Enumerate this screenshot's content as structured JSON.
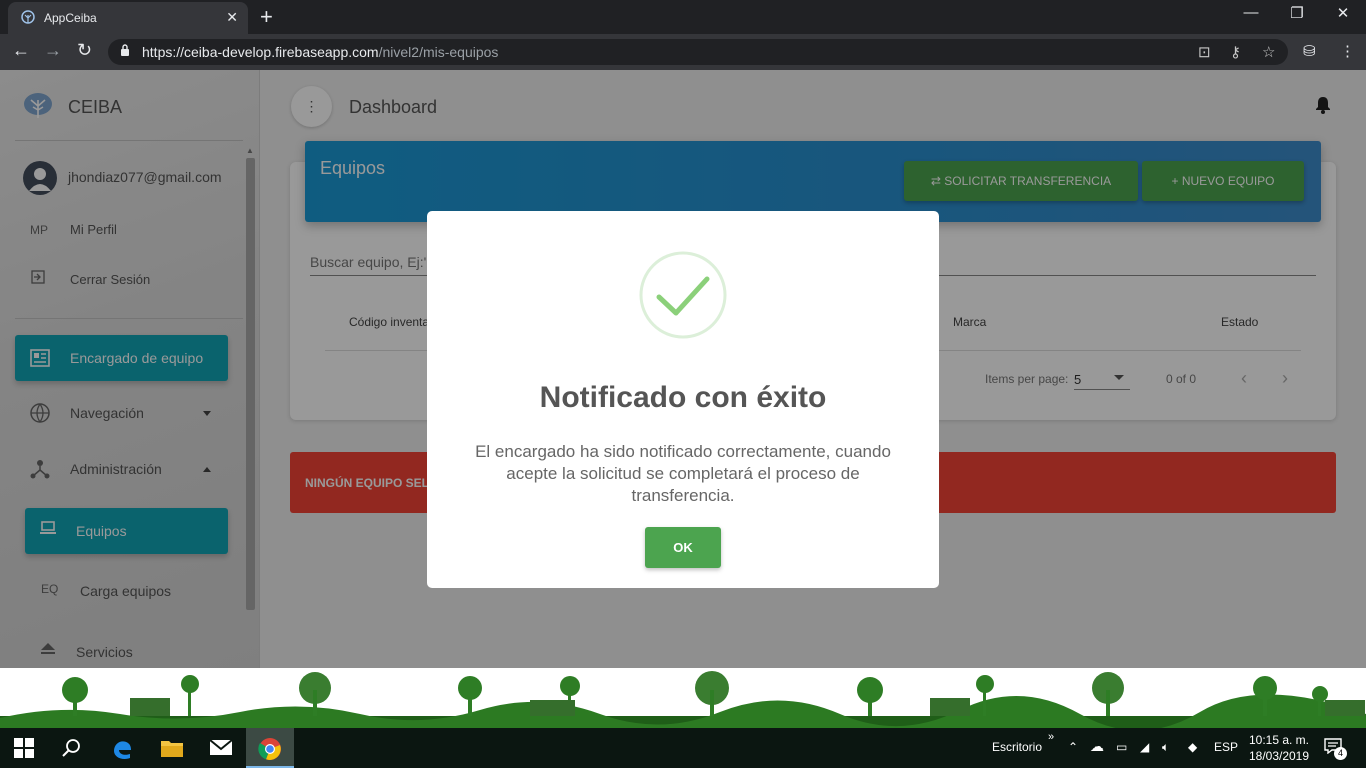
{
  "browser": {
    "tab_title": "AppCeiba",
    "url_host": "https://ceiba-develop.firebaseapp.com",
    "url_path": "/nivel2/mis-equipos"
  },
  "sidebar": {
    "brand": "CEIBA",
    "user_email": "jhondiaz077@gmail.com",
    "profile_abbr": "MP",
    "profile_label": "Mi Perfil",
    "logout_label": "Cerrar Sesión",
    "items": [
      {
        "label": "Encargado de equipo"
      },
      {
        "label": "Navegación"
      },
      {
        "label": "Administración"
      },
      {
        "label": "Equipos"
      },
      {
        "abbr": "EQ",
        "label": "Carga equipos"
      },
      {
        "label": "Servicios"
      }
    ]
  },
  "header": {
    "title": "Dashboard"
  },
  "card": {
    "title": "Equipos",
    "transfer_button": "SOLICITAR TRANSFERENCIA",
    "new_button": "NUEVO EQUIPO",
    "search_placeholder": "Buscar equipo, Ej:'N",
    "columns": [
      "Código inventa",
      "Marca",
      "Estado"
    ],
    "items_per_page_label": "Items per page:",
    "items_per_page_value": "5",
    "range_label": "0 of 0"
  },
  "alert": {
    "text": "NINGÚN EQUIPO SELEC"
  },
  "modal": {
    "title": "Notificado con éxito",
    "text": "El encargado ha sido notificado correctamente, cuando acepte la solicitud se completará el proceso de transferencia.",
    "ok_label": "OK"
  },
  "taskbar": {
    "desktop_label": "Escritorio",
    "language": "ESP",
    "time": "10:15 a. m.",
    "date": "18/03/2019",
    "notification_count": "4"
  },
  "colors": {
    "accent_teal": "#12a5b6",
    "header_blue": "#1a9ad6",
    "success_green": "#4ca44f",
    "danger_red": "#f44336"
  }
}
